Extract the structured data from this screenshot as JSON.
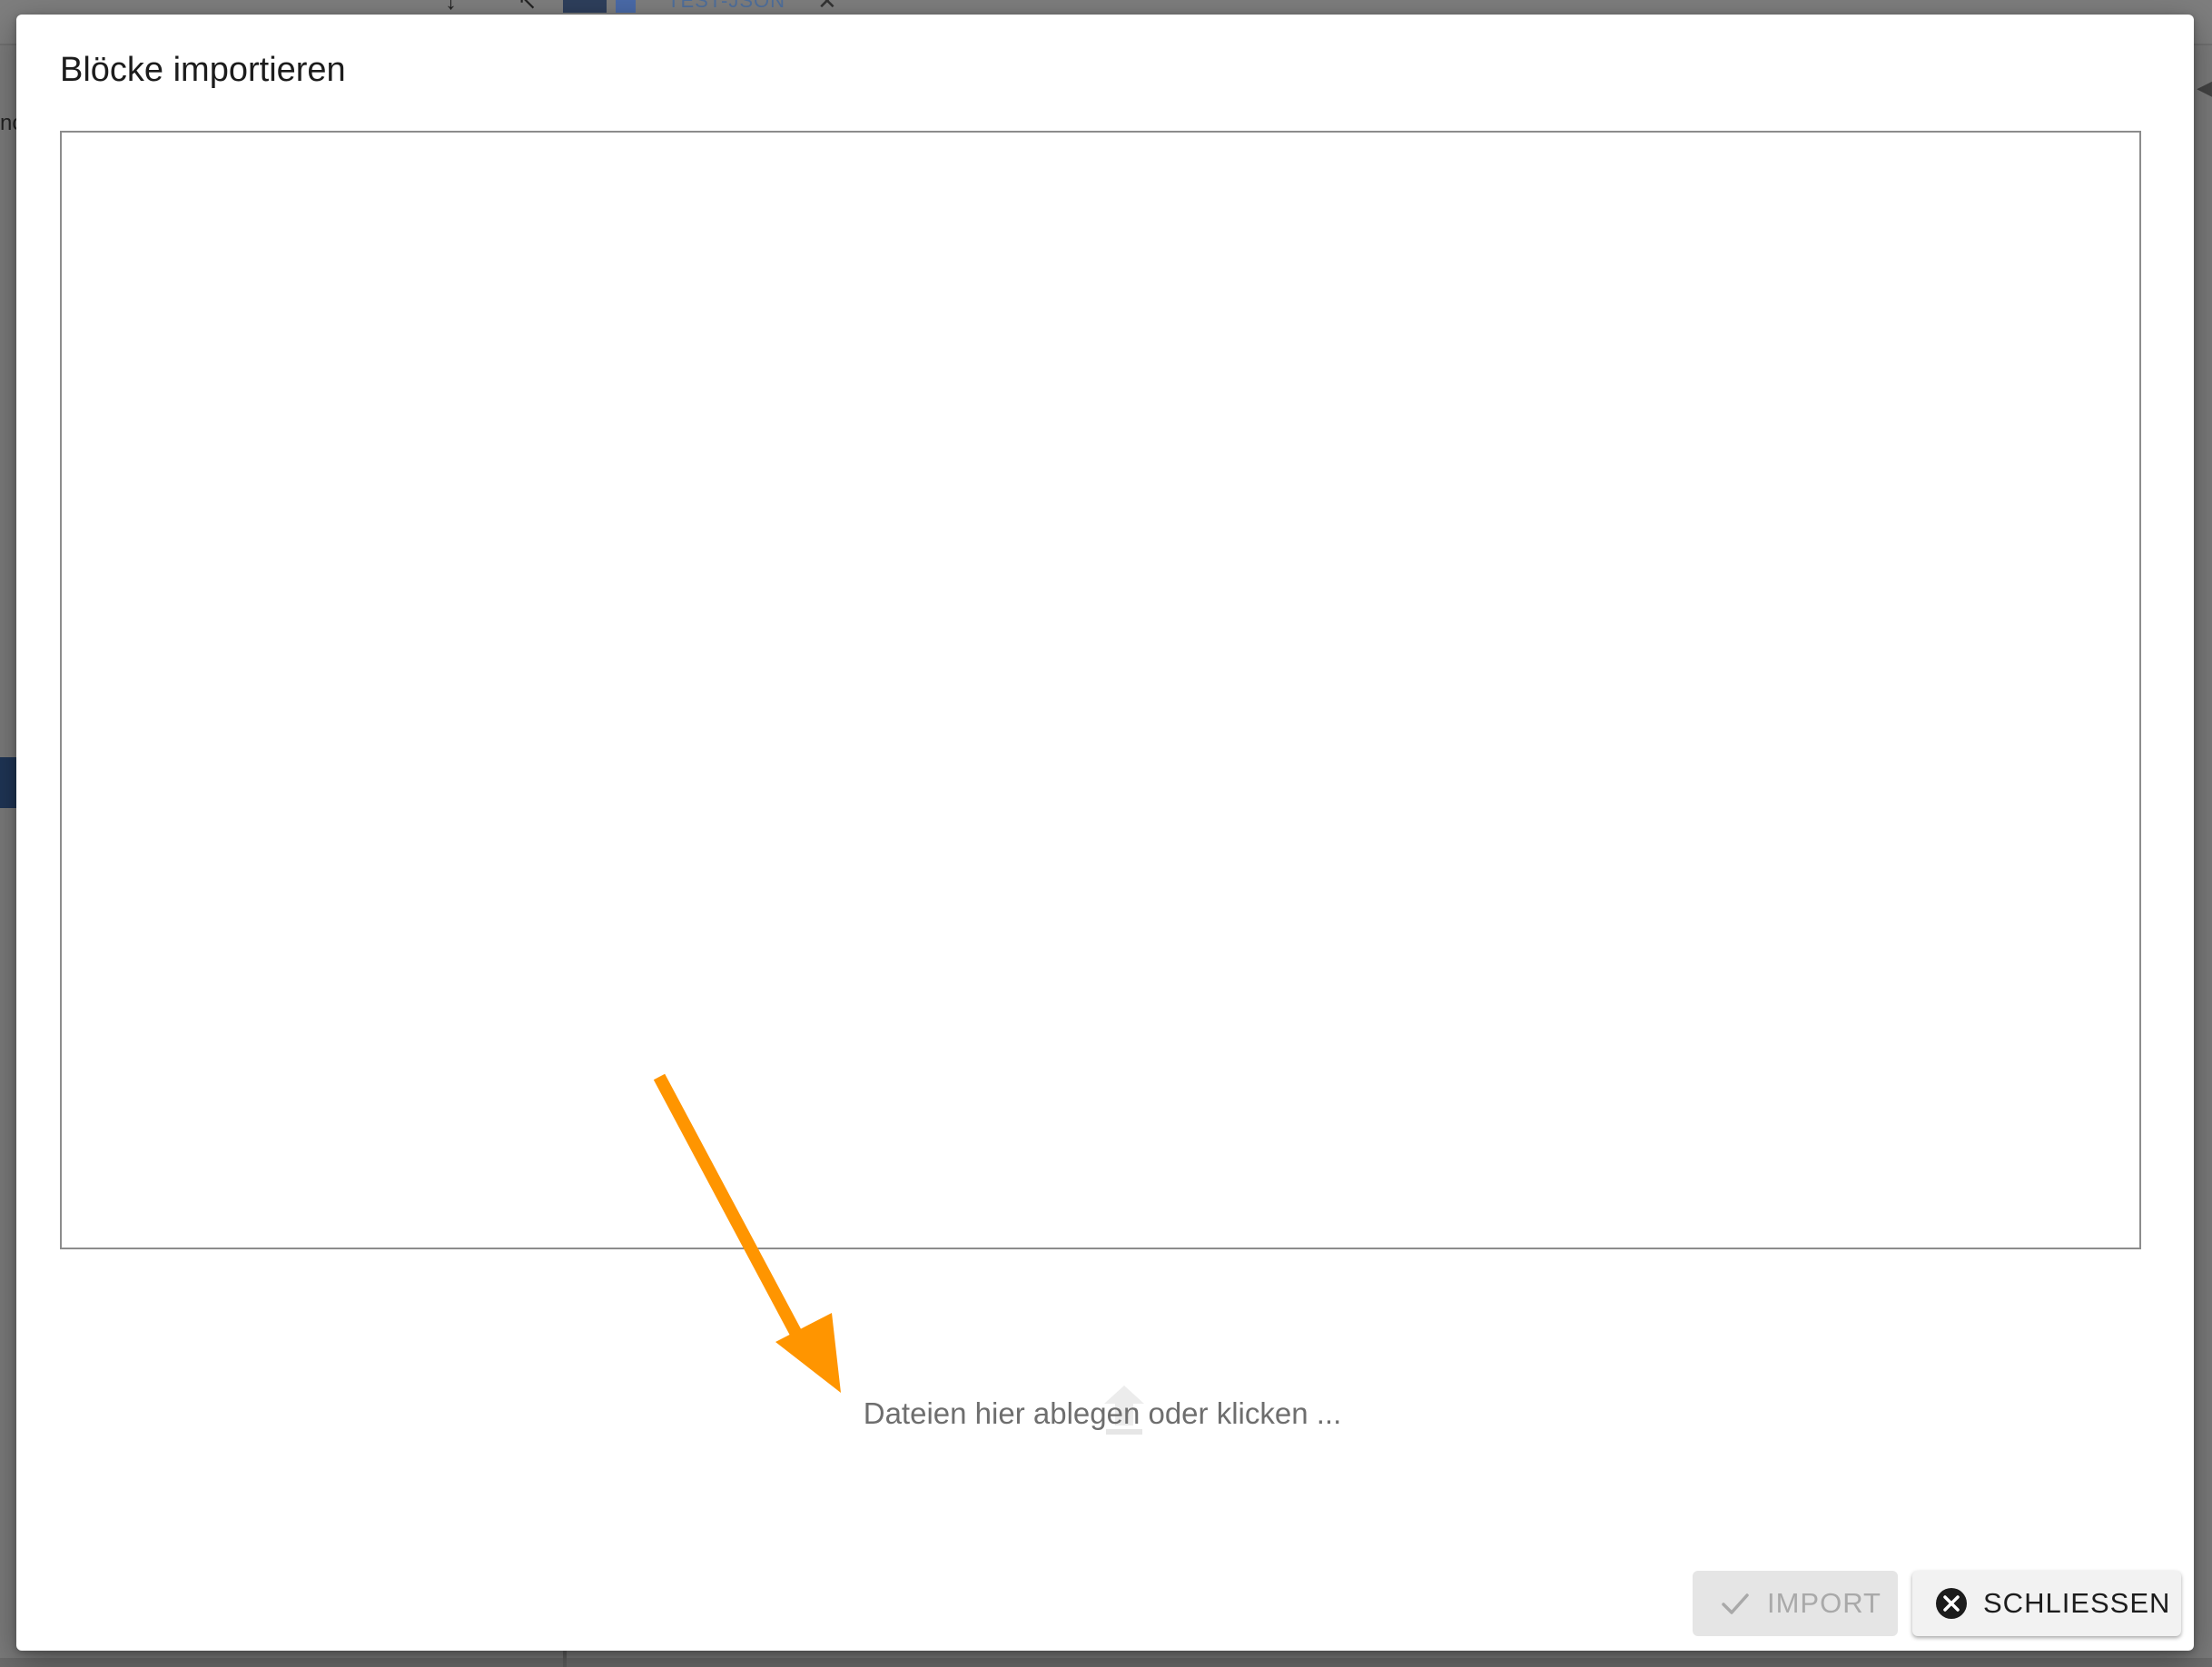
{
  "background": {
    "tab_label": "TEST-JSON",
    "tab_close_glyph": "✕",
    "side_text": "nc",
    "tool_a_glyph": "↕",
    "tool_b_glyph": "↖",
    "right_arrow_glyph": "◀"
  },
  "dialog": {
    "title": "Blöcke importieren",
    "editor_content": "",
    "dropzone": {
      "text": "Dateien hier ablegen oder klicken ...",
      "icon": "upload-icon"
    },
    "buttons": {
      "import_label": "IMPORT",
      "import_icon": "check-icon",
      "import_disabled": true,
      "close_label": "SCHLIESSEN",
      "close_icon": "close-circle-icon"
    }
  },
  "annotation": {
    "arrow_color": "#ff9500"
  },
  "colors": {
    "overlay": "#7b7b7b",
    "dialog_bg": "#ffffff",
    "editor_border": "#8c8c8c",
    "import_bg": "#e5e5e5",
    "import_text": "#a9a9a9",
    "close_bg": "#f2f2f2",
    "close_text": "#1c1c1c"
  }
}
